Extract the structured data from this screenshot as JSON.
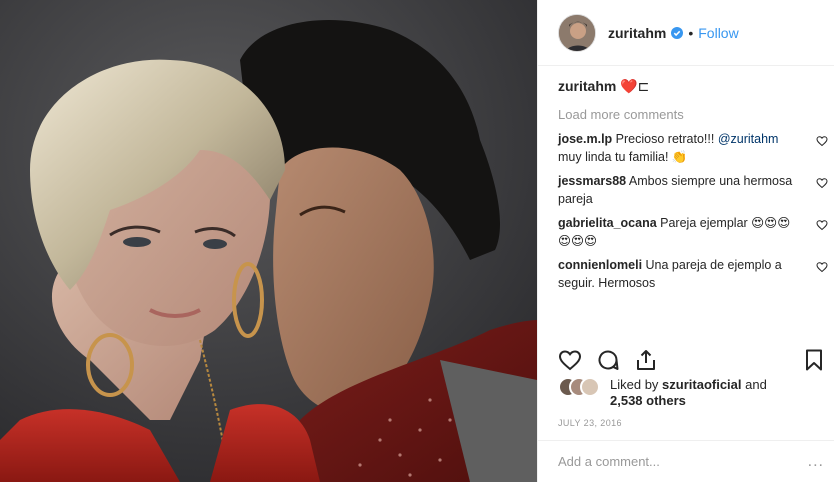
{
  "header": {
    "username": "zuritahm",
    "separator": "•",
    "follow_label": "Follow"
  },
  "caption": {
    "username": "zuritahm",
    "text": "❤️⊏"
  },
  "load_more": "Load more comments",
  "comments": [
    {
      "username": "jose.m.lp",
      "text": "Precioso retrato!!!",
      "mention": "@zuritahm",
      "text2": "muy linda tu familia! 👏"
    },
    {
      "username": "jessmars88",
      "text": "Ambos siempre una hermosa pareja"
    },
    {
      "username": "gabrielita_ocana",
      "text": "Pareja ejemplar 😍😍😍 😍😍😍"
    },
    {
      "username": "connienlomeli",
      "text": "Una pareja de ejemplo a seguir. Hermosos"
    }
  ],
  "likes": {
    "prefix": "Liked by",
    "user": "szuritaoficial",
    "middle": "and",
    "others": "2,538 others"
  },
  "date": "JULY 23, 2016",
  "add_comment": {
    "placeholder": "Add a comment..."
  },
  "more_label": "...",
  "icons": {
    "verified": "verified-badge-icon",
    "like": "heart-icon",
    "comment": "speech-bubble-icon",
    "share": "share-icon",
    "save": "bookmark-icon"
  },
  "colors": {
    "link": "#3897f0",
    "text": "#262626",
    "muted": "#999999",
    "border": "#efefef"
  }
}
